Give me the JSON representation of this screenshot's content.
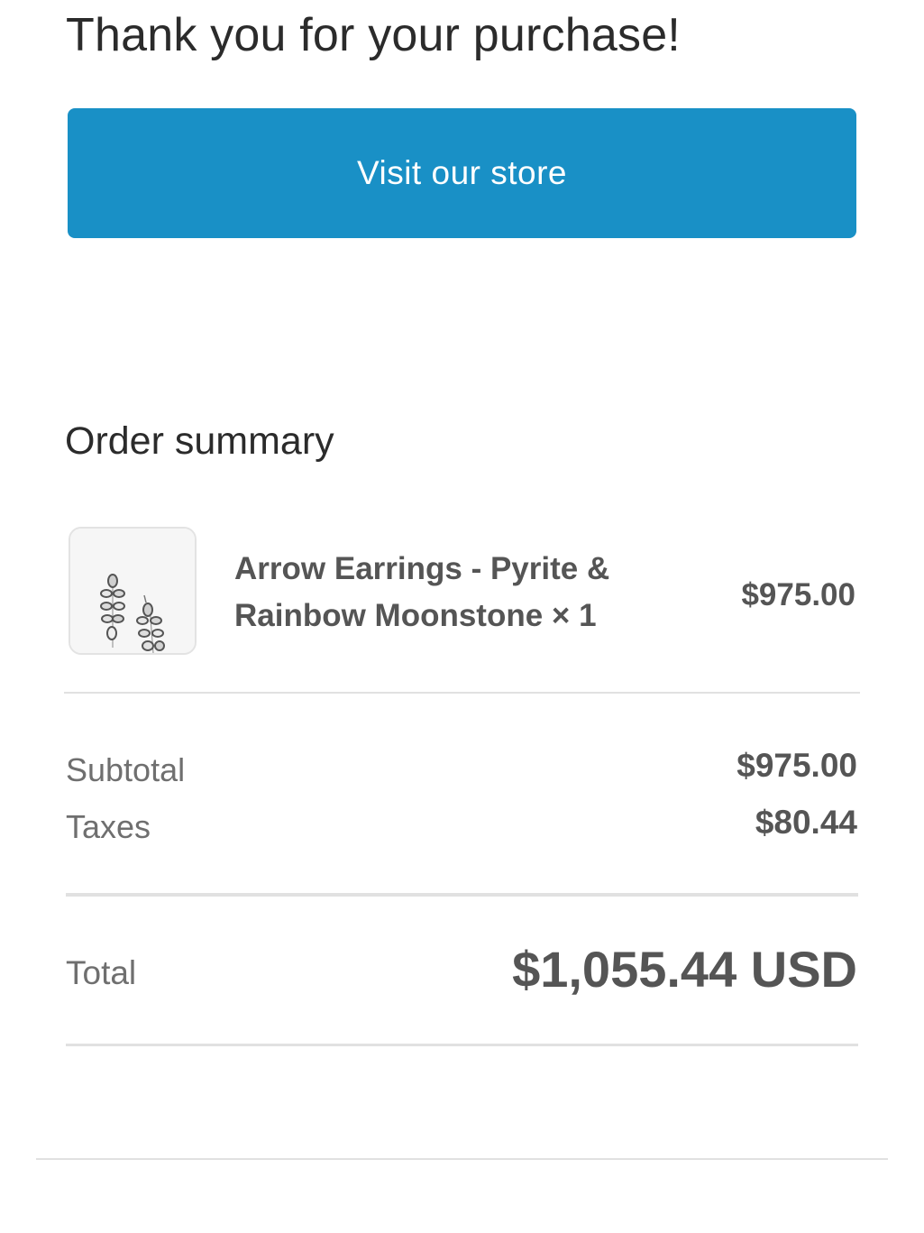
{
  "header": {
    "title": "Thank you for your purchase!"
  },
  "store_button": {
    "label": "Visit our store",
    "color": "#1990c6"
  },
  "order_summary": {
    "title": "Order summary",
    "items": [
      {
        "name": "Arrow Earrings - Pyrite & Rainbow Moonstone × 1",
        "price": "$975.00",
        "image": "earrings-thumbnail"
      }
    ],
    "subtotal_label": "Subtotal",
    "subtotal_value": "$975.00",
    "taxes_label": "Taxes",
    "taxes_value": "$80.44",
    "total_label": "Total",
    "total_value": "$1,055.44 USD"
  }
}
